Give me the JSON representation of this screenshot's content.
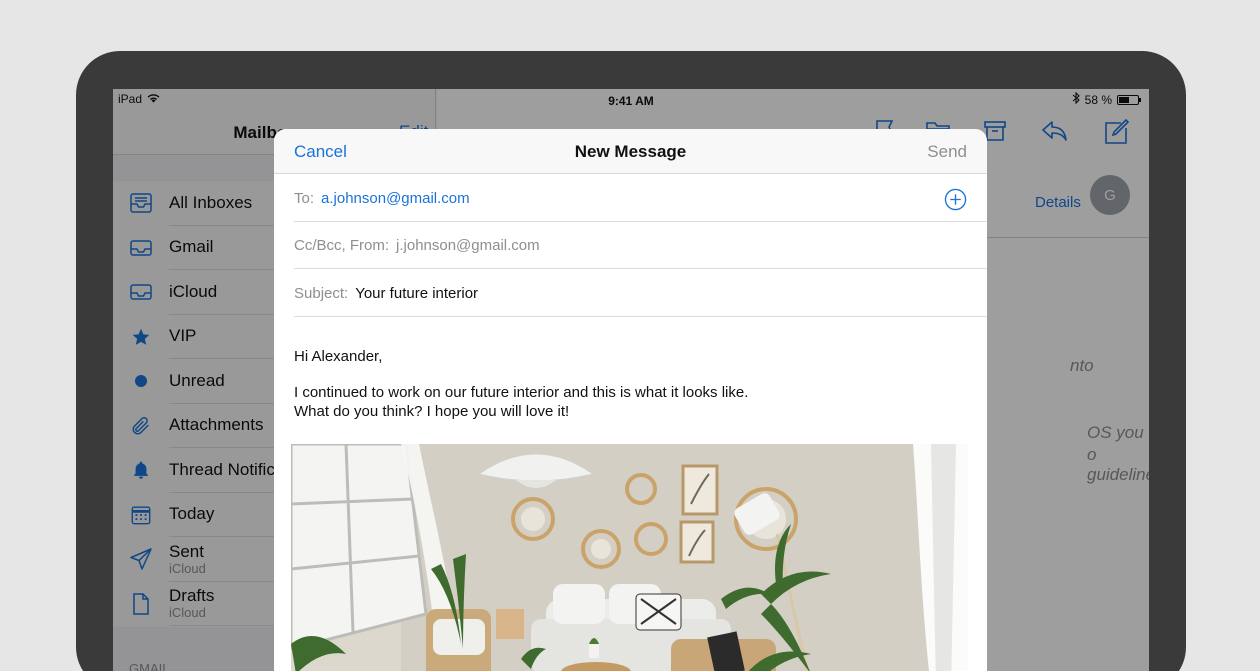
{
  "status_bar": {
    "device": "iPad",
    "time": "9:41 AM",
    "battery": "58 %",
    "battery_level": 0.58
  },
  "sidebar": {
    "title": "Mailboxes",
    "edit_label": "Edit",
    "mailboxes": [
      {
        "label": "All Inboxes",
        "icon": "tray-stack-icon"
      },
      {
        "label": "Gmail",
        "icon": "tray-icon"
      },
      {
        "label": "iCloud",
        "icon": "tray-icon"
      },
      {
        "label": "VIP",
        "icon": "star-icon"
      },
      {
        "label": "Unread",
        "icon": "dot-icon"
      },
      {
        "label": "Attachments",
        "icon": "paperclip-icon"
      },
      {
        "label": "Thread Notifications",
        "icon": "bell-icon"
      },
      {
        "label": "Today",
        "icon": "calendar-icon"
      },
      {
        "label": "Sent",
        "sub": "iCloud",
        "icon": "paper-plane-icon"
      },
      {
        "label": "Drafts",
        "sub": "iCloud",
        "icon": "document-icon"
      }
    ],
    "section_label": "GMAIL"
  },
  "detail": {
    "details_label": "Details",
    "avatar_initial": "G",
    "partial_lines": [
      "nto",
      "OS you",
      "o guidelines."
    ]
  },
  "compose": {
    "cancel_label": "Cancel",
    "title": "New Message",
    "send_label": "Send",
    "to_label": "To:",
    "to_value": "a.johnson@gmail.com",
    "ccbcc_label": "Cc/Bcc, From:",
    "from_value": "j.johnson@gmail.com",
    "subject_label": "Subject:",
    "subject_value": "Your future interior",
    "greeting": "Hi Alexander,",
    "body_line1": "I continued to work on our future interior and this is what it looks like.",
    "body_line2": "What do you think? I hope you will love it!"
  },
  "colors": {
    "accent": "#1a73d9",
    "page_bg": "#e6e6e6",
    "device_frame": "#3a3a3a"
  }
}
